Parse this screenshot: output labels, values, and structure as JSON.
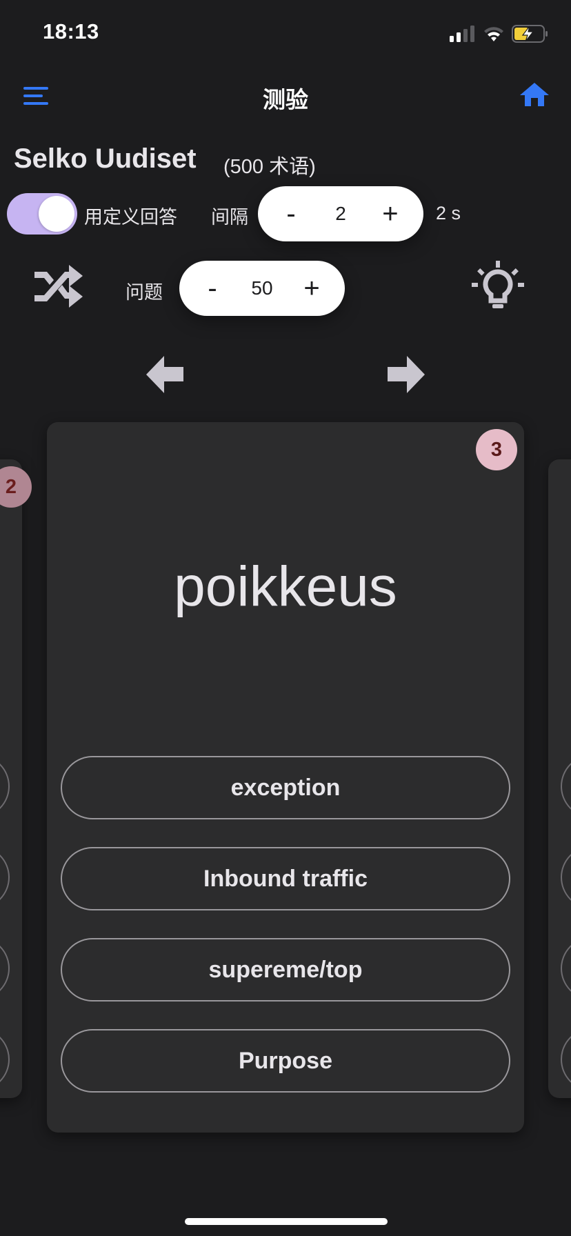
{
  "status_bar": {
    "time": "18:13",
    "icons": [
      "cellular-signal-icon",
      "wifi-icon",
      "battery-charging-icon"
    ]
  },
  "nav": {
    "title": "测验",
    "menu_icon": "hamburger-menu-icon",
    "home_icon": "home-icon"
  },
  "deck": {
    "title": "Selko Uudiset",
    "count": "(500 术语)"
  },
  "controls": {
    "toggle_label": "用定义回答",
    "toggle_on": true,
    "interval_label": "间隔",
    "interval": {
      "minus": "-",
      "value": "2",
      "plus": "+"
    },
    "interval_suffix": "2 s",
    "questions_label": "问题",
    "questions": {
      "minus": "-",
      "value": "50",
      "plus": "+"
    },
    "shuffle_icon": "shuffle-icon",
    "hint_icon": "lightbulb-icon"
  },
  "navigation": {
    "prev_icon": "arrow-left-icon",
    "next_icon": "arrow-right-icon"
  },
  "cards": {
    "prev": {
      "badge": "2"
    },
    "current": {
      "badge": "3",
      "term": "poikkeus",
      "options": [
        "exception",
        "Inbound traffic",
        "supereme/top",
        "Purpose"
      ]
    }
  },
  "colors": {
    "accent_blue": "#3478f6",
    "toggle_on": "#c6b4f2",
    "badge": "#e6bcc8",
    "background": "#1c1c1e",
    "card": "#2c2c2d"
  }
}
